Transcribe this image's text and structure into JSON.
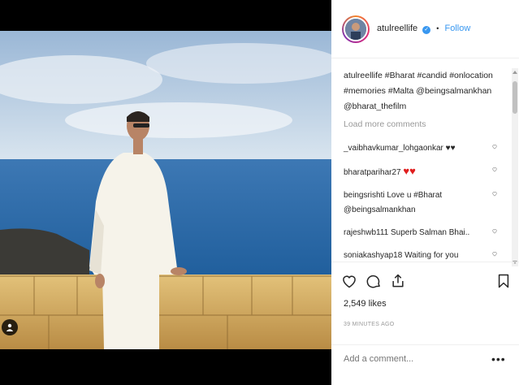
{
  "header": {
    "username": "atulreellife",
    "separator": "•",
    "follow_label": "Follow"
  },
  "caption": {
    "username": "atulreellife",
    "text": "#Bharat #candid #onlocation #memories #Malta @beingsalmankhan @bharat_thefilm"
  },
  "load_more_label": "Load more comments",
  "comments": [
    {
      "username": "_vaibhavkumar_lohgaonkar",
      "text": "♥♥"
    },
    {
      "username": "bharatparihar27",
      "text": "♥♥"
    },
    {
      "username": "beingsrishti",
      "text": "Love u #Bharat @beingsalmankhan"
    },
    {
      "username": "rajeshwb111",
      "text": "Superb Salman Bhai.."
    },
    {
      "username": "soniakashyap18",
      "text": "Waiting for you"
    }
  ],
  "likes_text": "2,549 likes",
  "timestamp": "39 MINUTES AGO",
  "add_comment_placeholder": "Add a comment...",
  "more_options": "•••",
  "icons": {
    "like": "heart-icon",
    "comment": "comment-icon",
    "share": "share-icon",
    "save": "bookmark-icon",
    "tag": "person-tag-icon"
  },
  "colors": {
    "follow": "#3897f0",
    "verified": "#3897f0",
    "red_heart": "#e01e1e",
    "muted": "#999999"
  }
}
